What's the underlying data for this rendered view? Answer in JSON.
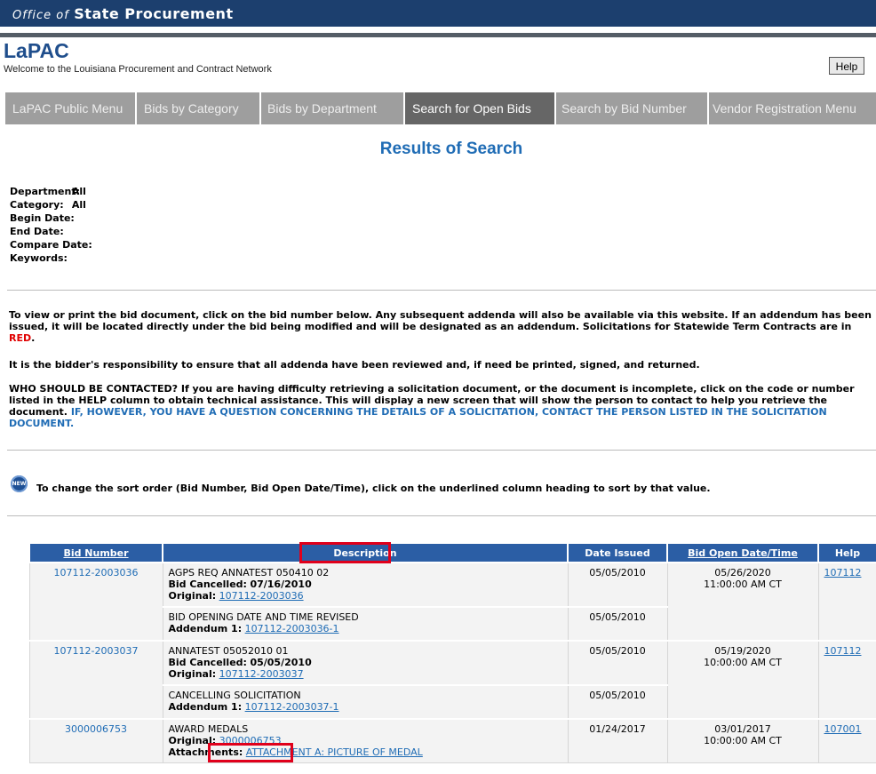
{
  "header": {
    "office_prefix": "Office of",
    "office_name": "State Procurement",
    "app_title": "LaPAC",
    "welcome": "Welcome to the Louisiana Procurement and Contract Network",
    "help_label": "Help"
  },
  "tabs": [
    {
      "label": "LaPAC Public Menu",
      "active": false
    },
    {
      "label": "Bids by Category",
      "active": false
    },
    {
      "label": "Bids by Department",
      "active": false
    },
    {
      "label": "Search for Open Bids",
      "active": true
    },
    {
      "label": "Search by Bid Number",
      "active": false
    },
    {
      "label": "Vendor Registration Menu",
      "active": false
    }
  ],
  "page_title": "Results of Search",
  "criteria": [
    {
      "label": "Department:",
      "value": "All"
    },
    {
      "label": "Category:",
      "value": "All"
    },
    {
      "label": "Begin Date:",
      "value": ""
    },
    {
      "label": "End Date:",
      "value": ""
    },
    {
      "label": "Compare Date:",
      "value": ""
    },
    {
      "label": "Keywords:",
      "value": ""
    }
  ],
  "info": {
    "p1_text": "To view or print the bid document, click on the bid number below. Any subsequent addenda will also be available via this website. If an addendum has been issued, it will be located directly under the bid being modified and will be designated as an addendum. Solicitations for Statewide Term Contracts are in ",
    "p1_red": "RED",
    "p1_end": ".",
    "p2": "It is the bidder's responsibility to ensure that all addenda have been reviewed and, if need be printed, signed, and returned.",
    "p3_text": "WHO SHOULD BE CONTACTED? If you are having difficulty retrieving a solicitation document, or the document is incomplete, click on the code or number listed in the HELP column to obtain technical assistance. This will display a new screen that will show the person to contact to help you retrieve the document. ",
    "p3_blue": "IF, HOWEVER, YOU HAVE A QUESTION CONCERNING THE DETAILS OF A SOLICITATION, CONTACT THE PERSON LISTED IN THE SOLICITATION DOCUMENT."
  },
  "new_badge": "NEW",
  "sort_note": "To change the sort order (Bid Number, Bid Open Date/Time), click on the underlined column heading to sort by that value.",
  "table": {
    "headers": {
      "bid_number": "Bid Number",
      "description": "Description",
      "date_issued": "Date Issued",
      "bid_open": "Bid Open Date/Time",
      "help": "Help"
    },
    "bids": [
      {
        "bid_number": "107112-2003036",
        "open_date": "05/26/2020",
        "open_time": "11:00:00 AM CT",
        "help": "107112",
        "main": {
          "title": "AGPS REQ ANNATEST 050410 02",
          "cancel_label": "Bid Cancelled:",
          "cancel_date": "07/16/2010",
          "orig_label": "Original:",
          "orig_link": "107112-2003036",
          "date_issued": "05/05/2010"
        },
        "addendum": {
          "title": "BID OPENING DATE AND TIME REVISED",
          "add_label": "Addendum 1:",
          "add_link": "107112-2003036-1",
          "date_issued": "05/05/2010"
        }
      },
      {
        "bid_number": "107112-2003037",
        "open_date": "05/19/2020",
        "open_time": "10:00:00 AM CT",
        "help": "107112",
        "main": {
          "title": "ANNATEST 05052010 01",
          "cancel_label": "Bid Cancelled:",
          "cancel_date": "05/05/2010",
          "orig_label": "Original:",
          "orig_link": "107112-2003037",
          "date_issued": "05/05/2010"
        },
        "addendum": {
          "title": "CANCELLING SOLICITATION",
          "add_label": "Addendum 1:",
          "add_link": "107112-2003037-1",
          "date_issued": "05/05/2010"
        }
      },
      {
        "bid_number": "3000006753",
        "open_date": "03/01/2017",
        "open_time": "10:00:00 AM CT",
        "help": "107001",
        "main": {
          "title": "AWARD MEDALS",
          "orig_label": "Original:",
          "orig_link": "3000006753",
          "att_label": "Attachments:",
          "att_link": "ATTACHMENT A: PICTURE OF MEDAL",
          "date_issued": "01/24/2017"
        }
      }
    ]
  },
  "colors": {
    "header_bg": "#1c3f6e",
    "table_header_bg": "#2b5ea5",
    "link": "#1f6cb5",
    "highlight": "#e0001b",
    "statewide_red": "#e00000"
  }
}
